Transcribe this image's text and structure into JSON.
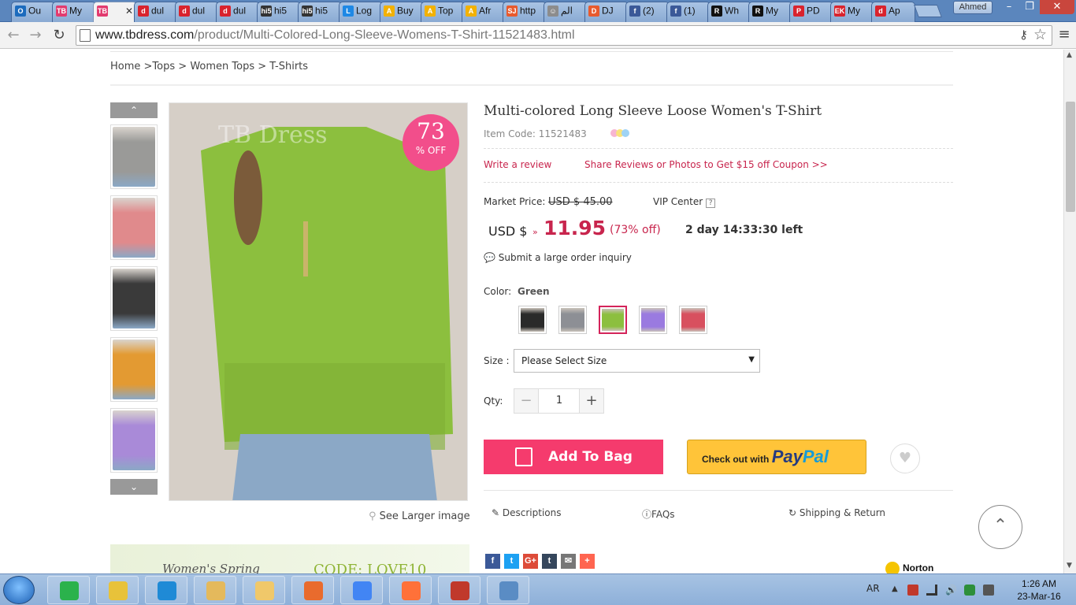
{
  "browser": {
    "tabs": [
      {
        "label": "Ou",
        "color": "#1c6bbd",
        "glyph": "O"
      },
      {
        "label": "My",
        "color": "#e23b6f",
        "glyph": "TB"
      },
      {
        "label": "",
        "color": "#e23b6f",
        "glyph": "TB"
      },
      {
        "label": "dul",
        "color": "#d9232d",
        "glyph": "d"
      },
      {
        "label": "dul",
        "color": "#d9232d",
        "glyph": "d"
      },
      {
        "label": "dul",
        "color": "#d9232d",
        "glyph": "d"
      },
      {
        "label": "hi5",
        "color": "#333333",
        "glyph": "hi5"
      },
      {
        "label": "hi5",
        "color": "#333333",
        "glyph": "hi5"
      },
      {
        "label": "Log",
        "color": "#1e88e5",
        "glyph": "L"
      },
      {
        "label": "Buy",
        "color": "#f2b100",
        "glyph": "A"
      },
      {
        "label": "Top",
        "color": "#f2b100",
        "glyph": "A"
      },
      {
        "label": "Afr",
        "color": "#f2b100",
        "glyph": "A"
      },
      {
        "label": "http",
        "color": "#e85a2d",
        "glyph": "SJ"
      },
      {
        "label": "الم",
        "color": "#8c8c8c",
        "glyph": "☺"
      },
      {
        "label": "DJ",
        "color": "#e85a2d",
        "glyph": "D"
      },
      {
        "label": "(2)",
        "color": "#3b5998",
        "glyph": "f"
      },
      {
        "label": "(1)",
        "color": "#3b5998",
        "glyph": "f"
      },
      {
        "label": "Wh",
        "color": "#111111",
        "glyph": "R"
      },
      {
        "label": "My",
        "color": "#111111",
        "glyph": "R"
      },
      {
        "label": "PD",
        "color": "#d9232d",
        "glyph": "P"
      },
      {
        "label": "My",
        "color": "#d9232d",
        "glyph": "EK"
      },
      {
        "label": "Ap",
        "color": "#d9232d",
        "glyph": "d"
      }
    ],
    "profile": "Ahmed",
    "url_host": "www.tbdress.com",
    "url_path": "/product/Multi-Colored-Long-Sleeve-Womens-T-Shirt-11521483.html"
  },
  "breadcrumb": {
    "home": "Home",
    "sep1": " >",
    "tops": "Tops",
    "sep2": " > ",
    "women_tops": "Women Tops",
    "sep3": " > ",
    "current": "T-Shirts"
  },
  "gallery": {
    "thumb_colors": [
      "#9a9a98",
      "#e08a8c",
      "#3a3a3a",
      "#e39a32",
      "#a98ad8"
    ],
    "main_color": "#8cbf3e",
    "watermark": "TB Dress",
    "badge_number": "73",
    "badge_text": "% OFF",
    "see_larger": "See Larger image"
  },
  "product": {
    "title": "Multi-colored Long Sleeve Loose Women's T-Shirt",
    "item_code": "Item Code: 11521483",
    "write_review": "Write a review",
    "share_reviews": "Share Reviews or Photos to Get $15 off Coupon >>",
    "market_price_label": "Market Price:",
    "market_price_value": "USD $ 45.00",
    "vip_center": "VIP Center",
    "currency": "USD $",
    "price": "11.95",
    "percent_off": "(73% off)",
    "countdown": "2 day 14:33:30 left",
    "inquiry": "Submit a large order inquiry",
    "color_label": "Color:",
    "color_value": "Green",
    "swatches": [
      {
        "name": "black",
        "color": "#2a2a2a"
      },
      {
        "name": "gray",
        "color": "#8d8f95"
      },
      {
        "name": "green",
        "color": "#8cbf3e"
      },
      {
        "name": "purple",
        "color": "#9a7ae0"
      },
      {
        "name": "red",
        "color": "#d8505f"
      }
    ],
    "size_label": "Size :",
    "size_placeholder": "Please Select Size",
    "qty_label": "Qty:",
    "qty_value": "1",
    "add_to_bag": "Add To Bag",
    "paypal_prefix": "Check out with",
    "paypal_pay": "Pay",
    "paypal_pal": "Pal"
  },
  "product_tabs": [
    "Descriptions",
    "FAQs",
    "Shipping & Return"
  ],
  "banner": {
    "left": "Women's Spring",
    "right": "CODE: LOVE10"
  },
  "social": [
    {
      "glyph": "f",
      "color": "#3b5998"
    },
    {
      "glyph": "t",
      "color": "#1da1f2"
    },
    {
      "glyph": "G+",
      "color": "#dd4b39"
    },
    {
      "glyph": "t",
      "color": "#35465c"
    },
    {
      "glyph": "✉",
      "color": "#777777"
    },
    {
      "glyph": "+",
      "color": "#ff6550"
    }
  ],
  "norton": "Norton",
  "taskbar": {
    "apps": [
      "#2bb24c",
      "#e8c23a",
      "#1f8ad6",
      "#e4b95c",
      "#f0c86a",
      "#e96b2d",
      "#4285f4",
      "#ff7139",
      "#c0392b",
      "#5a8cc4"
    ],
    "lang": "AR",
    "time": "1:26 AM",
    "date": "23-Mar-16"
  }
}
